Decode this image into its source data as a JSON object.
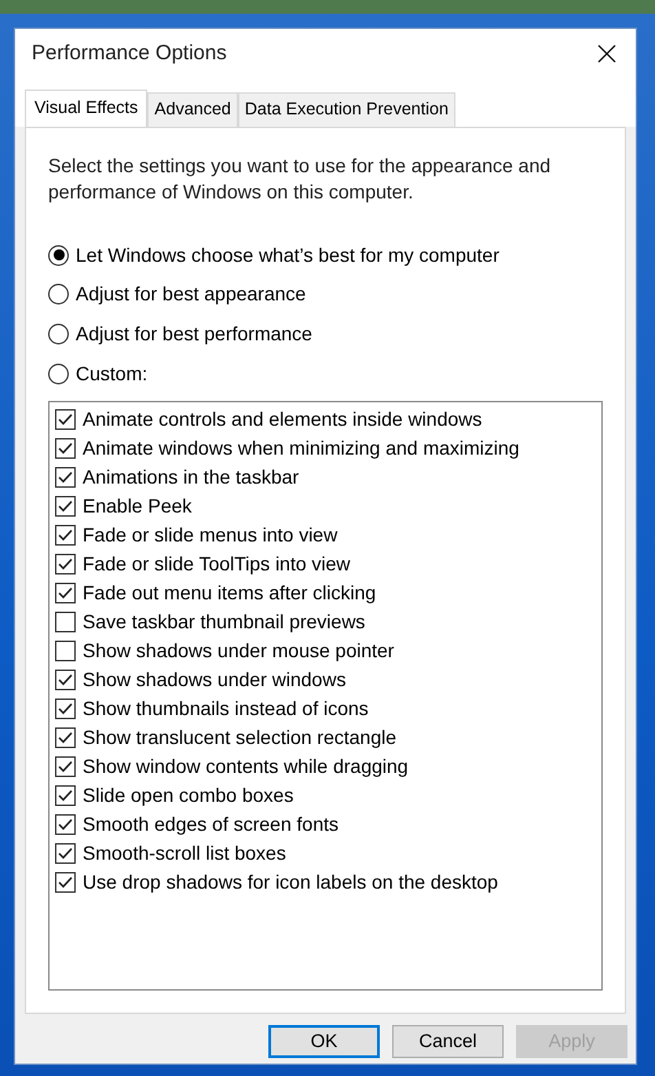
{
  "window": {
    "title": "Performance Options"
  },
  "tabs": [
    {
      "label": "Visual Effects",
      "selected": true
    },
    {
      "label": "Advanced",
      "selected": false
    },
    {
      "label": "Data Execution Prevention",
      "selected": false
    }
  ],
  "description": "Select the settings you want to use for the appearance and performance of Windows on this computer.",
  "options": [
    {
      "label": "Let Windows choose what’s best for my computer",
      "selected": true
    },
    {
      "label": "Adjust for best appearance",
      "selected": false
    },
    {
      "label": "Adjust for best performance",
      "selected": false
    },
    {
      "label": "Custom:",
      "selected": false
    }
  ],
  "effects": [
    {
      "label": "Animate controls and elements inside windows",
      "checked": true
    },
    {
      "label": "Animate windows when minimizing and maximizing",
      "checked": true
    },
    {
      "label": "Animations in the taskbar",
      "checked": true
    },
    {
      "label": "Enable Peek",
      "checked": true
    },
    {
      "label": "Fade or slide menus into view",
      "checked": true
    },
    {
      "label": "Fade or slide ToolTips into view",
      "checked": true
    },
    {
      "label": "Fade out menu items after clicking",
      "checked": true
    },
    {
      "label": "Save taskbar thumbnail previews",
      "checked": false
    },
    {
      "label": "Show shadows under mouse pointer",
      "checked": false
    },
    {
      "label": "Show shadows under windows",
      "checked": true
    },
    {
      "label": "Show thumbnails instead of icons",
      "checked": true
    },
    {
      "label": "Show translucent selection rectangle",
      "checked": true
    },
    {
      "label": "Show window contents while dragging",
      "checked": true
    },
    {
      "label": "Slide open combo boxes",
      "checked": true
    },
    {
      "label": "Smooth edges of screen fonts",
      "checked": true
    },
    {
      "label": "Smooth-scroll list boxes",
      "checked": true
    },
    {
      "label": "Use drop shadows for icon labels on the desktop",
      "checked": true
    }
  ],
  "buttons": [
    {
      "label": "OK",
      "default": true,
      "disabled": false
    },
    {
      "label": "Cancel",
      "default": false,
      "disabled": false
    },
    {
      "label": "Apply",
      "default": false,
      "disabled": true
    }
  ]
}
